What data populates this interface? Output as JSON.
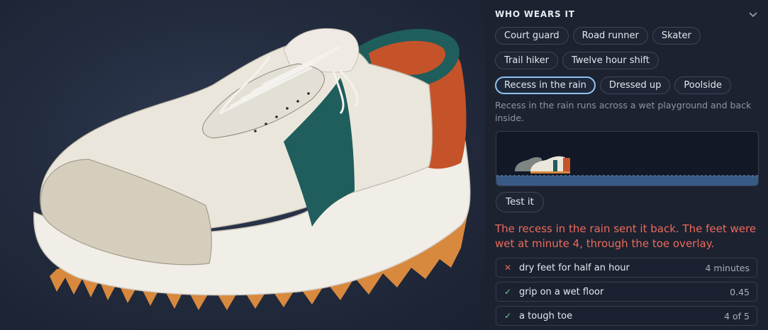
{
  "section": {
    "title": "WHO WEARS IT"
  },
  "personas": [
    [
      "Court guard",
      "Road runner",
      "Skater"
    ],
    [
      "Trail hiker",
      "Twelve hour shift"
    ],
    [
      "Recess in the rain",
      "Dressed up",
      "Poolside"
    ]
  ],
  "selected_persona": "Recess in the rain",
  "persona_description": "Recess in the rain runs across a wet playground and back inside.",
  "test_button_label": "Test it",
  "result_message": "The recess in the rain sent it back. The feet were wet at minute 4, through the toe overlay.",
  "checks": [
    {
      "status": "fail",
      "label": "dry feet for half an hour",
      "value": "4 minutes"
    },
    {
      "status": "pass",
      "label": "grip on a wet floor",
      "value": "0.45"
    },
    {
      "status": "pass",
      "label": "a tough toe",
      "value": "4 of 5"
    }
  ],
  "colors": {
    "shoe_body": "#ebe6dc",
    "stripe": "#1f5e5c",
    "heel": "#c4532a",
    "toe_cap": "#d6cebd",
    "outsole": "#d8893e",
    "accent_selected": "#8ec3f5",
    "fail": "#ee6a5c",
    "pass": "#6fcf8f"
  },
  "icons": {
    "collapse": "chevron-down-icon",
    "fail": "cross-icon",
    "pass": "check-icon"
  }
}
